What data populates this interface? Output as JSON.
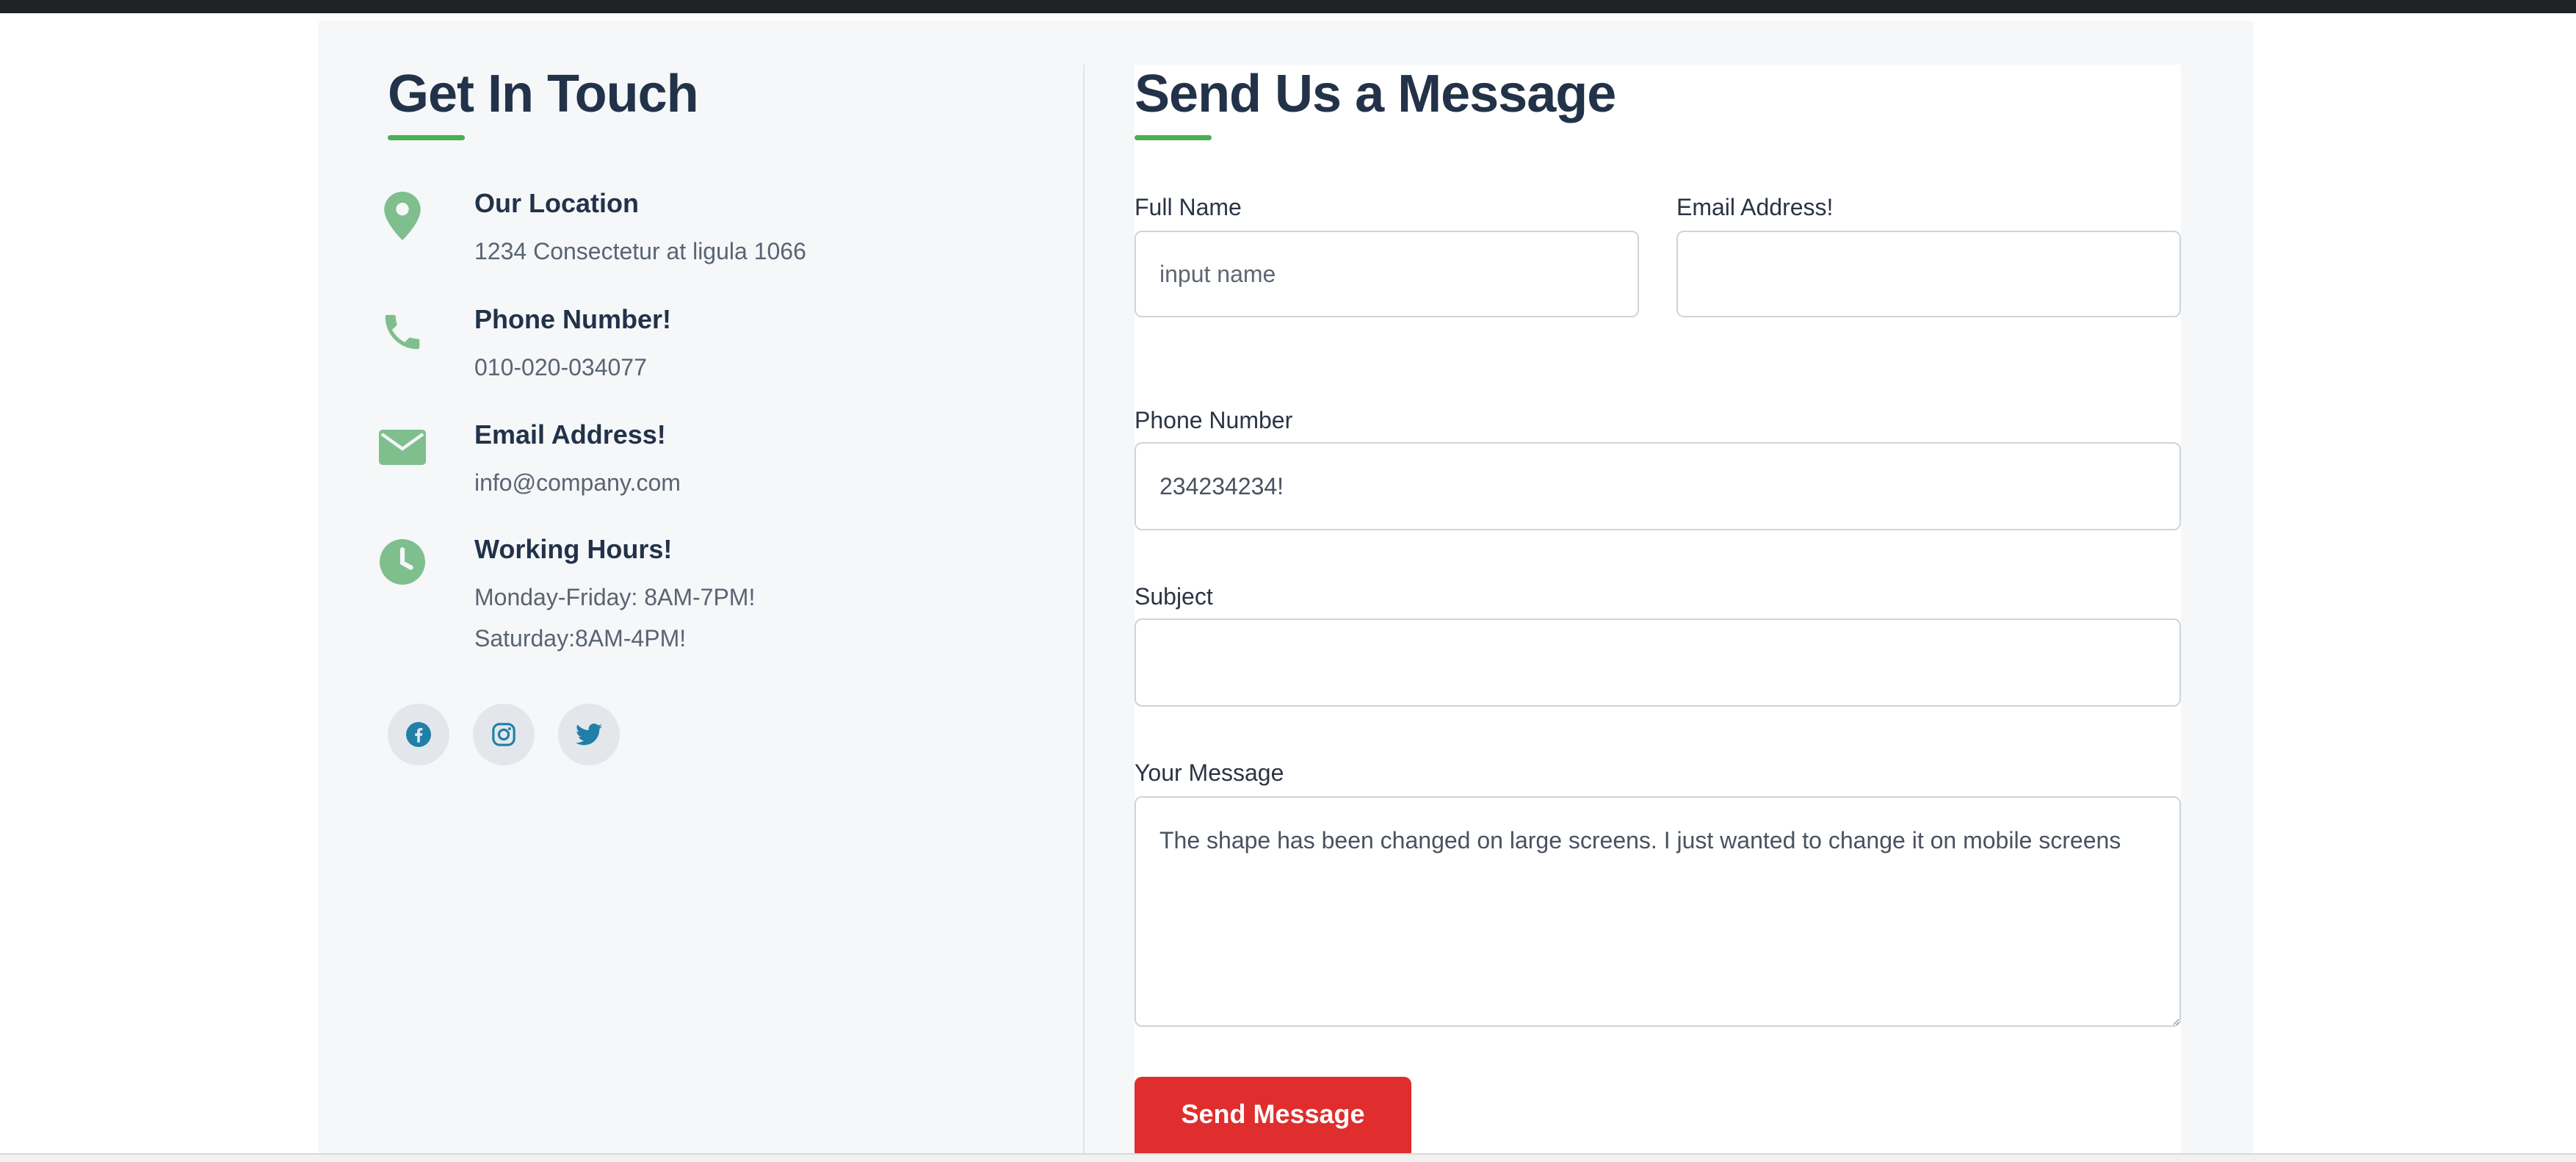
{
  "colors": {
    "accent_green": "#4caf50",
    "icon_green": "#7fbf8e",
    "social_blue": "#1f7fa8",
    "button_red": "#e02d2d",
    "heading_navy": "#223249"
  },
  "contact_info": {
    "heading": "Get In Touch",
    "items": [
      {
        "icon": "location-pin-icon",
        "title": "Our Location",
        "lines": [
          "1234 Consectetur at ligula 1066"
        ]
      },
      {
        "icon": "phone-icon",
        "title": "Phone Number!",
        "lines": [
          "010-020-034077"
        ]
      },
      {
        "icon": "envelope-icon",
        "title": "Email Address!",
        "lines": [
          "info@company.com"
        ]
      },
      {
        "icon": "clock-icon",
        "title": "Working Hours!",
        "lines": [
          "Monday-Friday: 8AM-7PM!",
          "Saturday:8AM-4PM!"
        ]
      }
    ],
    "socials": [
      {
        "icon": "facebook-icon"
      },
      {
        "icon": "instagram-icon"
      },
      {
        "icon": "twitter-icon"
      }
    ]
  },
  "form": {
    "heading": "Send Us a Message",
    "full_name": {
      "label": "Full Name",
      "value": "",
      "placeholder": "input name"
    },
    "email": {
      "label": "Email Address!",
      "value": "",
      "placeholder": ""
    },
    "phone": {
      "label": "Phone Number",
      "value": "234234234!",
      "placeholder": ""
    },
    "subject": {
      "label": "Subject",
      "value": "",
      "placeholder": ""
    },
    "message": {
      "label": "Your Message",
      "value": "The shape has been changed on large screens. I just wanted to change it on mobile screens",
      "placeholder": ""
    },
    "submit_label": "Send Message"
  }
}
